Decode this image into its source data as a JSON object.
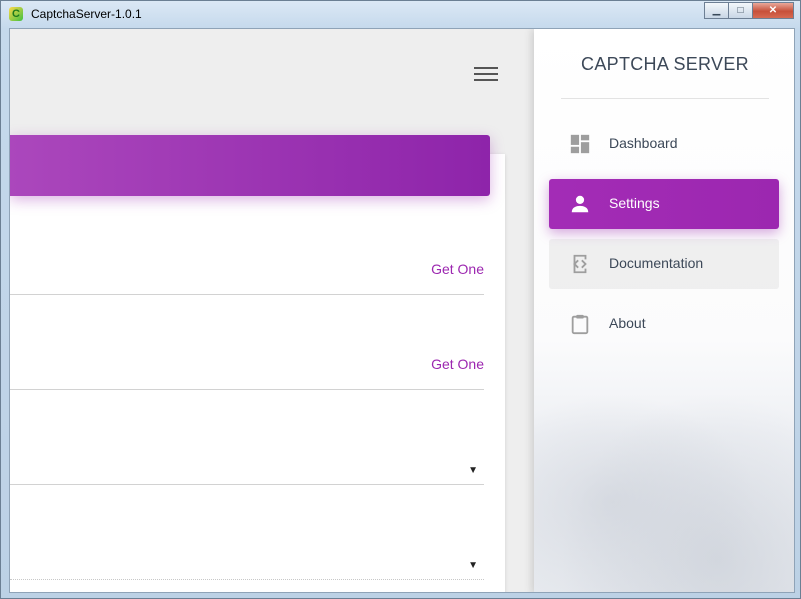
{
  "window": {
    "title": "CaptchaServer-1.0.1",
    "app_icon_letter": "C",
    "minimize_glyph": "▁",
    "maximize_glyph": "□",
    "close_glyph": "✕"
  },
  "main": {
    "fields": [
      {
        "action_label": "Get One",
        "type": "text"
      },
      {
        "action_label": "Get One",
        "type": "text"
      },
      {
        "caret": "▼",
        "type": "select"
      },
      {
        "caret": "▼",
        "type": "select"
      }
    ]
  },
  "sidebar": {
    "brand": "CAPTCHA SERVER",
    "items": [
      {
        "label": "Dashboard",
        "icon": "dashboard-icon",
        "state": "normal"
      },
      {
        "label": "Settings",
        "icon": "person-icon",
        "state": "active"
      },
      {
        "label": "Documentation",
        "icon": "code-doc-icon",
        "state": "hover"
      },
      {
        "label": "About",
        "icon": "clipboard-icon",
        "state": "normal"
      }
    ]
  },
  "colors": {
    "accent": "#9c27b0",
    "text_dark": "#3c4858"
  }
}
